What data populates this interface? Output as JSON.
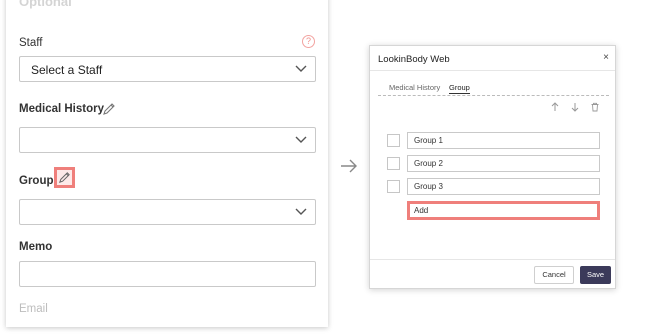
{
  "form": {
    "section_title": "Optional",
    "staff_label": "Staff",
    "staff_help": "?",
    "staff_select": "Select a Staff",
    "medical_history_label": "Medical History",
    "medical_history_value": "",
    "group_label": "Group",
    "group_value": "",
    "memo_label": "Memo",
    "memo_value": "",
    "email_label": "Email"
  },
  "dialog": {
    "title": "LookinBody Web",
    "close": "×",
    "tabs": [
      "Medical History",
      "Group"
    ],
    "active_tab": "Group",
    "groups": [
      "Group 1",
      "Group 2",
      "Group 3"
    ],
    "add_value": "Add",
    "cancel_label": "Cancel",
    "save_label": "Save"
  },
  "colors": {
    "highlight": "#ef7f7b",
    "save_button": "#3b3a5a"
  },
  "icons": [
    "help-icon",
    "chevron-down-icon",
    "pencil-icon",
    "arrow-right-icon",
    "arrow-up-icon",
    "arrow-down-icon",
    "trash-icon",
    "close-icon"
  ]
}
